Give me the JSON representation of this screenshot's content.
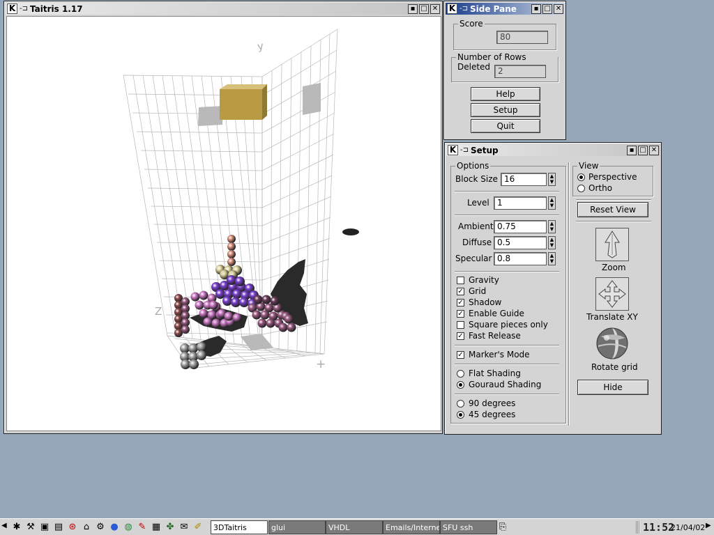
{
  "colors": {
    "desktop": "#96a7ba",
    "active_title": "#1a3c8a",
    "canvas": "#ffffff",
    "grid": "#bdbdbd",
    "block_gold": "#b89a42"
  },
  "game_window": {
    "title": "Taitris 1.17",
    "axis_labels": {
      "y": "y",
      "z": "Z",
      "x": "+"
    }
  },
  "side_pane": {
    "title": "Side Pane",
    "score_label": "Score",
    "score_value": "80",
    "rows_label": "Number of Rows Deleted",
    "rows_value": "2",
    "help_label": "Help",
    "setup_label": "Setup",
    "quit_label": "Quit"
  },
  "setup": {
    "title": "Setup",
    "options_label": "Options",
    "block_size_label": "Block Size",
    "block_size_value": "16",
    "level_label": "Level",
    "level_value": "1",
    "ambient_label": "Ambient",
    "ambient_value": "0.75",
    "diffuse_label": "Diffuse",
    "diffuse_value": "0.5",
    "specular_label": "Specular",
    "specular_value": "0.8",
    "checkboxes": [
      {
        "label": "Gravity",
        "checked": false
      },
      {
        "label": "Grid",
        "checked": true
      },
      {
        "label": "Shadow",
        "checked": true
      },
      {
        "label": "Enable Guide",
        "checked": true
      },
      {
        "label": "Square pieces only",
        "checked": false
      },
      {
        "label": "Fast Release",
        "checked": true
      }
    ],
    "markers_mode": {
      "label": "Marker's Mode",
      "checked": true
    },
    "shading": [
      {
        "label": "Flat Shading",
        "selected": false
      },
      {
        "label": "Gouraud Shading",
        "selected": true
      }
    ],
    "angle": [
      {
        "label": "90 degrees",
        "selected": false
      },
      {
        "label": "45 degrees",
        "selected": true
      }
    ],
    "view_label": "View",
    "view_modes": [
      {
        "label": "Perspective",
        "selected": true
      },
      {
        "label": "Ortho",
        "selected": false
      }
    ],
    "reset_view_label": "Reset View",
    "zoom_label": "Zoom",
    "translate_label": "Translate XY",
    "rotate_label": "Rotate grid",
    "hide_label": "Hide"
  },
  "taskbar": {
    "launcher_icons": [
      "k-menu-icon",
      "tools-icon",
      "terminal-icon",
      "monitor-icon",
      "help-icon",
      "home-icon",
      "settings-icon",
      "browser-icon",
      "globe-icon",
      "editor-icon",
      "chart-icon",
      "network-icon",
      "mail-icon",
      "pencil-icon"
    ],
    "tasks": [
      {
        "label": "3DTaitris",
        "active": true
      },
      {
        "label": "glui",
        "active": false
      },
      {
        "label": "VHDL",
        "active": false
      },
      {
        "label": "Emails/Internet",
        "active": false
      },
      {
        "label": "SFU ssh",
        "active": false
      }
    ],
    "clock": "11:52",
    "date": "21/04/02"
  }
}
